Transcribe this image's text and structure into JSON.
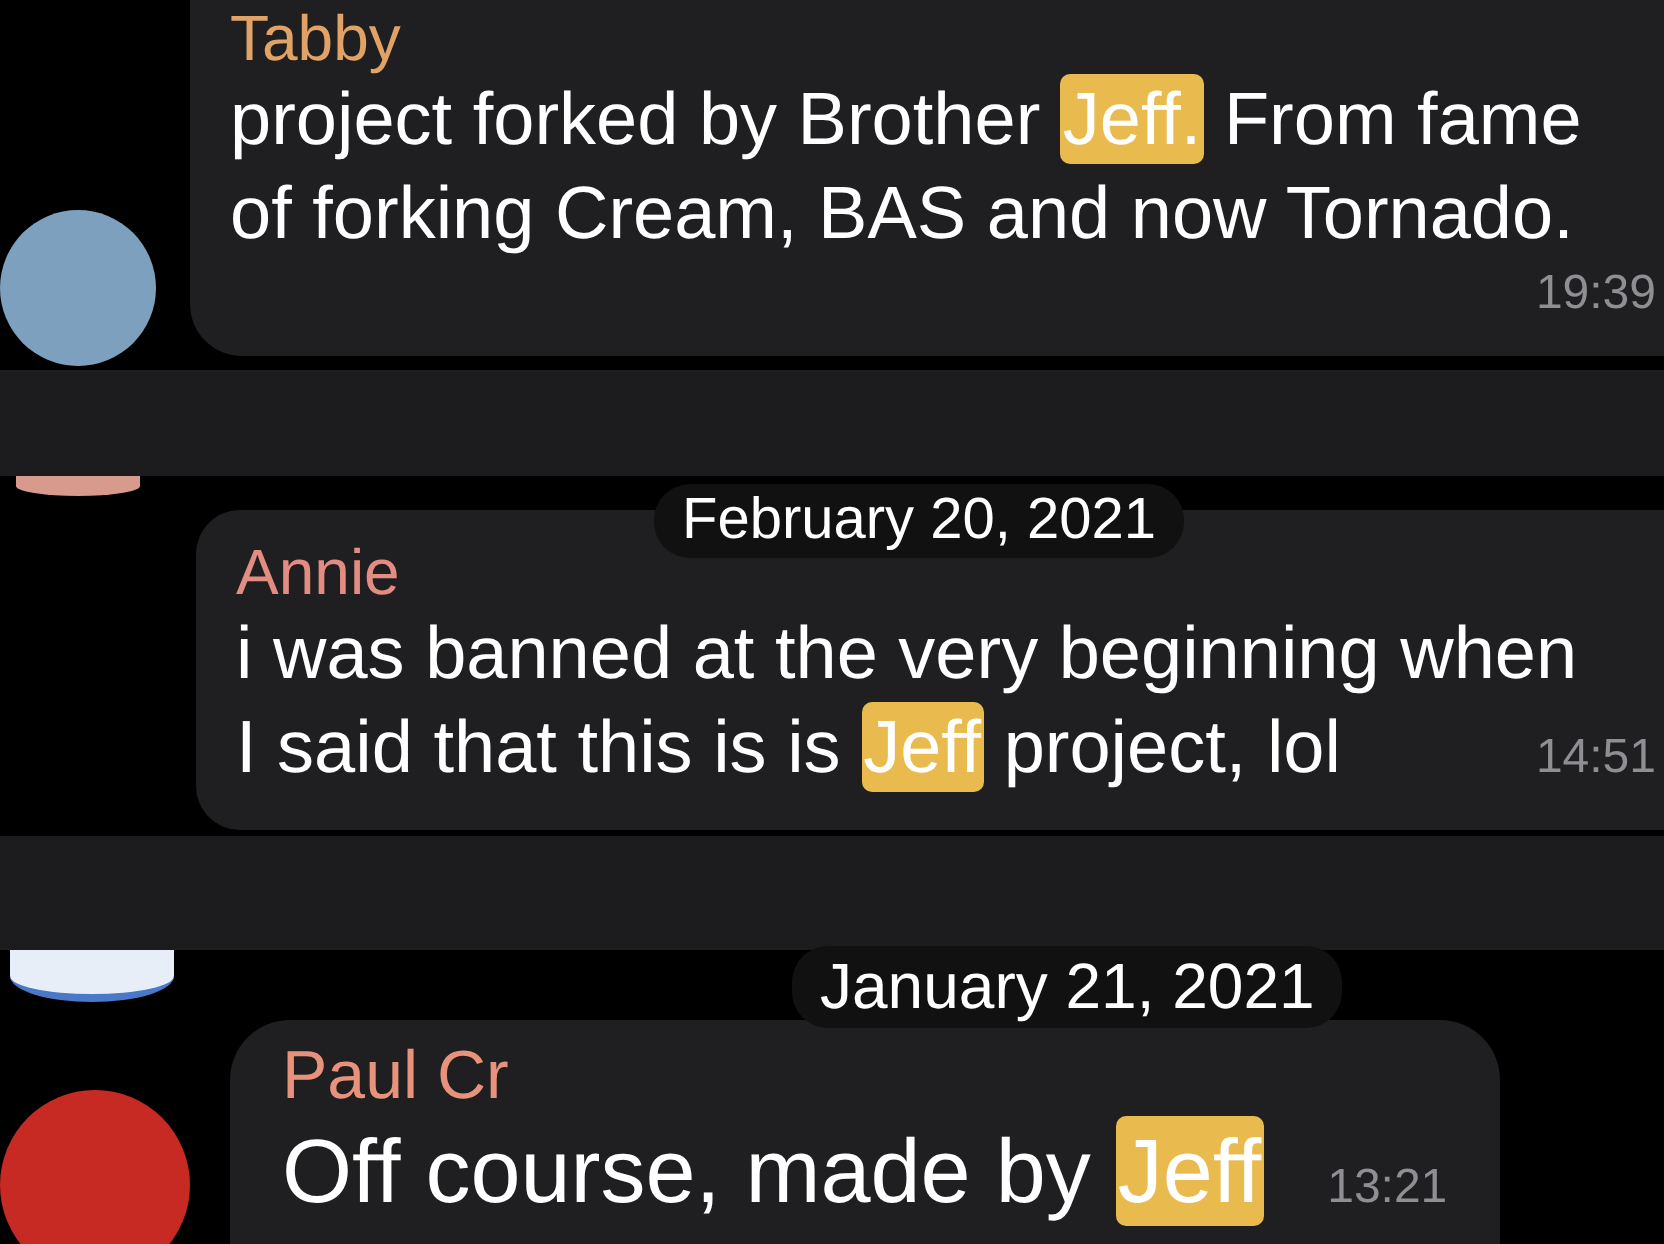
{
  "messages": [
    {
      "sender": "Tabby",
      "color": "#e0a266",
      "lines": [
        [
          {
            "text": "project forked by Brother ",
            "highlight": false
          },
          {
            "text": "Jeff.",
            "highlight": true
          },
          {
            "text": " From fame",
            "highlight": false
          }
        ],
        [
          {
            "text": "of forking Cream, BAS and now Tornado.",
            "highlight": false
          }
        ]
      ],
      "time": "19:39"
    },
    {
      "date": "February 20, 2021",
      "sender": "Annie",
      "color": "#e38c82",
      "lines": [
        [
          {
            "text": "i was banned at the very beginning when",
            "highlight": false
          }
        ],
        [
          {
            "text": "I said that this is is ",
            "highlight": false
          },
          {
            "text": "Jeff",
            "highlight": true
          },
          {
            "text": " project, lol",
            "highlight": false
          }
        ]
      ],
      "time": "14:51"
    },
    {
      "date": "January 21, 2021",
      "sender": "Paul Cr",
      "color": "#e8927c",
      "lines": [
        [
          {
            "text": "Off course, made by ",
            "highlight": false
          },
          {
            "text": "Jeff",
            "highlight": true
          }
        ]
      ],
      "time": "13:21"
    }
  ]
}
